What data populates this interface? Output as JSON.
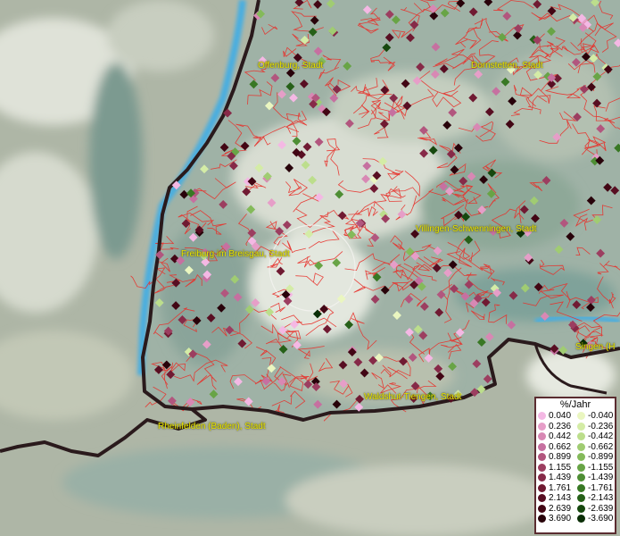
{
  "cities": [
    {
      "id": "offenburg",
      "name": "Offenburg, Stadt"
    },
    {
      "id": "dornstetten",
      "name": "Dornstetten, Stadt"
    },
    {
      "id": "villingen",
      "name": "Villingen-Schwenningen, Stadt"
    },
    {
      "id": "freiburg",
      "name": "Freiburg im Breisgau, Stadt"
    },
    {
      "id": "singen",
      "name": "Singen (H"
    },
    {
      "id": "waldshut",
      "name": "Waldshut-Tiengen, Stadt"
    },
    {
      "id": "rheinfelden",
      "name": "Rheinfelden (Baden), Stadt"
    }
  ],
  "legend": {
    "title": "%/Jahr",
    "positive": [
      {
        "label": "0.040",
        "color": "#f4b8e4"
      },
      {
        "label": "0.236",
        "color": "#e69ec8"
      },
      {
        "label": "0.442",
        "color": "#d888b4"
      },
      {
        "label": "0.662",
        "color": "#c670a0"
      },
      {
        "label": "0.899",
        "color": "#b2567e"
      },
      {
        "label": "1.155",
        "color": "#9c3e60"
      },
      {
        "label": "1.439",
        "color": "#862a48"
      },
      {
        "label": "1.761",
        "color": "#701a32"
      },
      {
        "label": "2.143",
        "color": "#580e22"
      },
      {
        "label": "2.639",
        "color": "#420614"
      },
      {
        "label": "3.690",
        "color": "#28020a"
      }
    ],
    "negative": [
      {
        "label": "-0.040",
        "color": "#eaf6c0"
      },
      {
        "label": "-0.236",
        "color": "#d4eca6"
      },
      {
        "label": "-0.442",
        "color": "#bcde8c"
      },
      {
        "label": "-0.662",
        "color": "#a0cc72"
      },
      {
        "label": "-0.899",
        "color": "#84ba5a"
      },
      {
        "label": "-1.155",
        "color": "#68a446"
      },
      {
        "label": "-1.439",
        "color": "#4e8e34"
      },
      {
        "label": "-1.761",
        "color": "#387824"
      },
      {
        "label": "-2.143",
        "color": "#266018"
      },
      {
        "label": "-2.639",
        "color": "#16480e"
      },
      {
        "label": "-3.690",
        "color": "#0a2e06"
      }
    ]
  },
  "colors": {
    "border": "#2a1a1c",
    "admin_lines": "#e8302a",
    "water": "#4aaee0",
    "label_text": "#e8e400"
  }
}
